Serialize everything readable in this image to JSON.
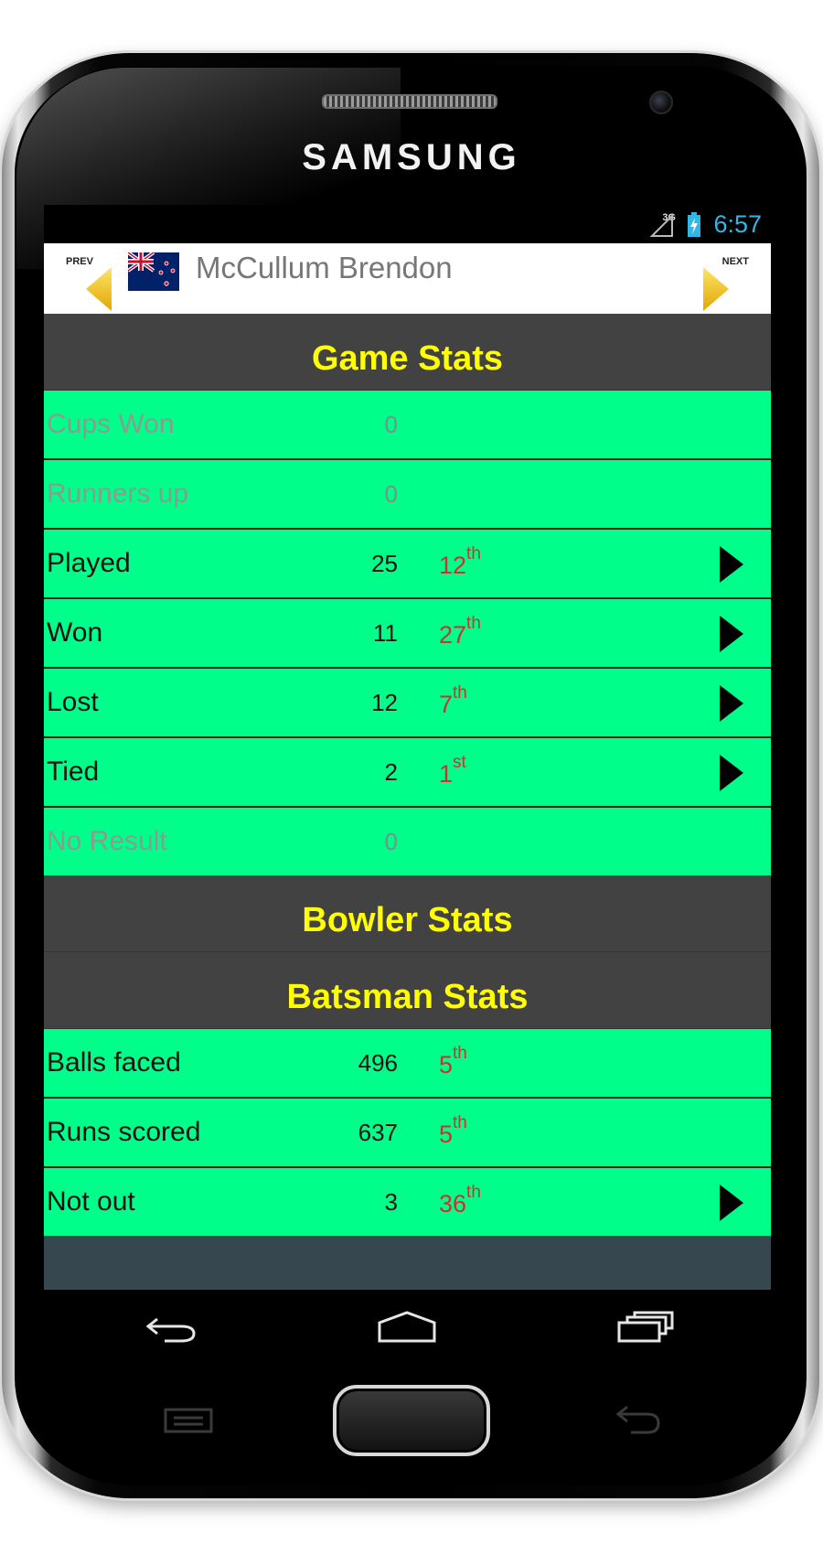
{
  "device": {
    "brand": "SAMSUNG"
  },
  "status_bar": {
    "network": "3G",
    "time": "6:57",
    "time_color": "#33b5e5"
  },
  "header": {
    "prev_label": "PREV",
    "next_label": "NEXT",
    "player_name": "McCullum Brendon",
    "flag_icon": "new-zealand-flag-icon",
    "arrow_color": "#f5c518"
  },
  "sections": {
    "game": {
      "title": "Game Stats",
      "rows": [
        {
          "label": "Cups Won",
          "value": "0",
          "rank": "",
          "suffix": "",
          "disabled": true
        },
        {
          "label": "Runners up",
          "value": "0",
          "rank": "",
          "suffix": "",
          "disabled": true
        },
        {
          "label": "Played",
          "value": "25",
          "rank": "12",
          "suffix": "th",
          "disabled": false
        },
        {
          "label": "Won",
          "value": "11",
          "rank": "27",
          "suffix": "th",
          "disabled": false
        },
        {
          "label": "Lost",
          "value": "12",
          "rank": "7",
          "suffix": "th",
          "disabled": false
        },
        {
          "label": "Tied",
          "value": "2",
          "rank": "1",
          "suffix": "st",
          "disabled": false
        },
        {
          "label": "No Result",
          "value": "0",
          "rank": "",
          "suffix": "",
          "disabled": true
        }
      ]
    },
    "bowler": {
      "title": "Bowler Stats"
    },
    "batsman": {
      "title": "Batsman Stats",
      "rows": [
        {
          "label": "Balls faced",
          "value": "496",
          "rank": "5",
          "suffix": "th",
          "disabled": false
        },
        {
          "label": "Runs scored",
          "value": "637",
          "rank": "5",
          "suffix": "th",
          "disabled": false
        },
        {
          "label": "Not out",
          "value": "3",
          "rank": "36",
          "suffix": "th",
          "disabled": false
        }
      ]
    }
  },
  "colors": {
    "row_bg": "#00ff8a",
    "section_bg": "#424242",
    "section_title": "#ffff00",
    "rank": "#d32f2f"
  }
}
